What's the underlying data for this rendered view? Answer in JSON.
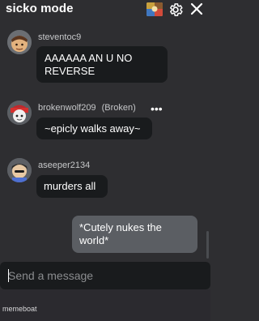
{
  "header": {
    "title": "sicko mode",
    "icons": [
      "avatar-thumbnail",
      "gear-icon",
      "close-icon"
    ]
  },
  "messages": [
    {
      "username": "steventoc9",
      "text": "AAAAAA AN U NO REVERSE"
    },
    {
      "username": "brokenwolf209",
      "tag": "(Broken)",
      "text": "~epicly walks away~"
    },
    {
      "username": "aseeper2134",
      "text": "murders all"
    },
    {
      "own": true,
      "text": "*Cutely nukes the world*"
    }
  ],
  "input": {
    "placeholder": "Send a message",
    "value": ""
  },
  "footer": {
    "text": "memeboat"
  },
  "colors": {
    "background": "#2e2e31",
    "bubble": "#191b1d",
    "own_bubble": "#5b5e63",
    "username": "#c6c7c9"
  }
}
